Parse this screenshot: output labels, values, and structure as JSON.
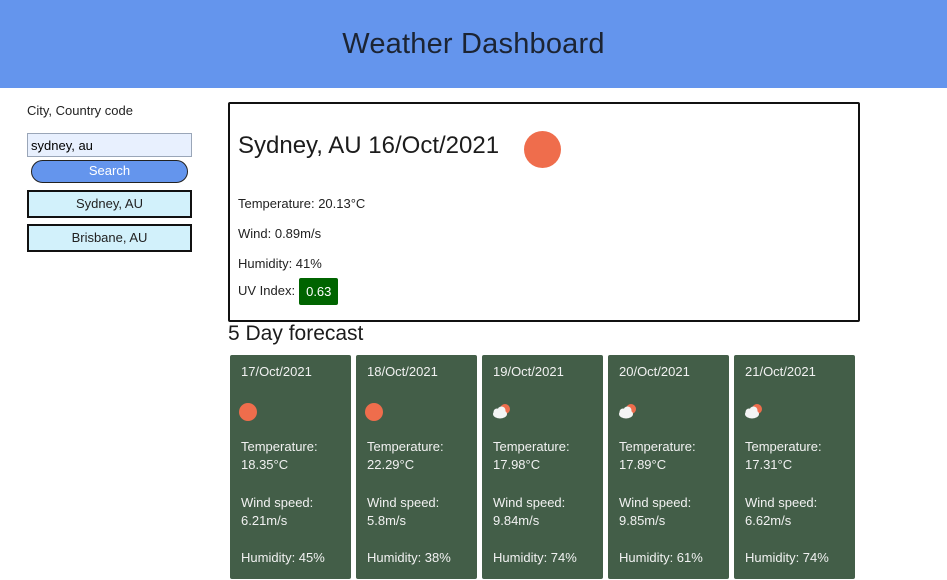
{
  "header": {
    "title": "Weather Dashboard"
  },
  "sidebar": {
    "label": "City, Country code",
    "search_value": "sydney, au",
    "search_button": "Search",
    "history": [
      "Sydney, AU",
      "Brisbane, AU"
    ]
  },
  "current": {
    "title": "Sydney, AU 16/Oct/2021",
    "icon": "sun-icon",
    "temperature": "Temperature: 20.13°C",
    "wind": "Wind: 0.89m/s",
    "humidity": "Humidity: 41%",
    "uv_label": "UV Index:",
    "uv_value": "0.63"
  },
  "forecast_title": "5 Day forecast",
  "forecast": [
    {
      "date": "17/Oct/2021",
      "icon": "sun-icon",
      "temp_label": "Temperature:",
      "temp": "18.35°C",
      "wind_label": "Wind speed:",
      "wind": "6.21m/s",
      "humidity": "Humidity: 45%"
    },
    {
      "date": "18/Oct/2021",
      "icon": "sun-icon",
      "temp_label": "Temperature:",
      "temp": "22.29°C",
      "wind_label": "Wind speed:",
      "wind": "5.8m/s",
      "humidity": "Humidity: 38%"
    },
    {
      "date": "19/Oct/2021",
      "icon": "partly-cloudy-icon",
      "temp_label": "Temperature:",
      "temp": "17.98°C",
      "wind_label": "Wind speed:",
      "wind": "9.84m/s",
      "humidity": "Humidity: 74%"
    },
    {
      "date": "20/Oct/2021",
      "icon": "partly-cloudy-icon",
      "temp_label": "Temperature:",
      "temp": "17.89°C",
      "wind_label": "Wind speed:",
      "wind": "9.85m/s",
      "humidity": "Humidity: 61%"
    },
    {
      "date": "21/Oct/2021",
      "icon": "partly-cloudy-icon",
      "temp_label": "Temperature:",
      "temp": "17.31°C",
      "wind_label": "Wind speed:",
      "wind": "6.62m/s",
      "humidity": "Humidity: 74%"
    }
  ],
  "colors": {
    "header": "#6495ed",
    "card": "#435e48",
    "sun": "#ef6d4c",
    "uv_badge": "#006400",
    "history_bg": "#d2f1fb"
  }
}
